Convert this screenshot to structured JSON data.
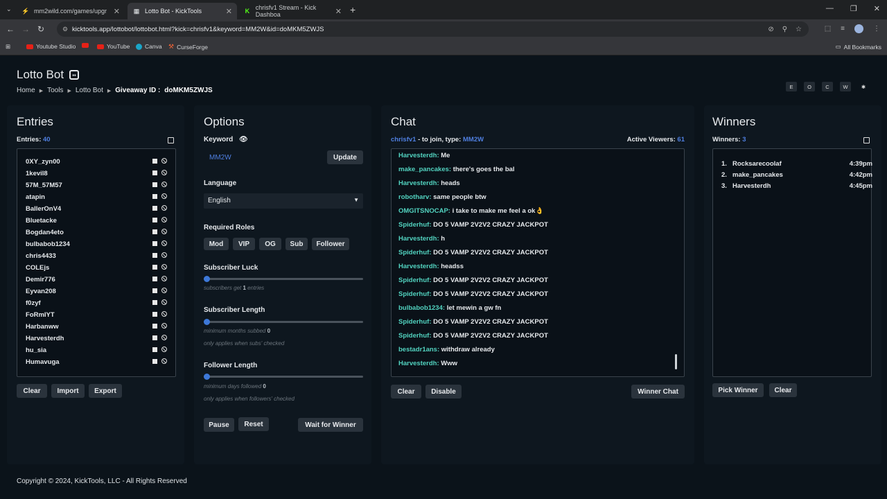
{
  "browser": {
    "tabs": [
      {
        "title": "mm2wild.com/games/upgr",
        "active": false
      },
      {
        "title": "Lotto Bot - KickTools",
        "active": true
      },
      {
        "title": "chrisfv1 Stream - Kick Dashboa",
        "active": false
      }
    ],
    "url": "kicktools.app/lottobot/lottobot.html?kick=chrisfv1&keyword=MM2W&id=doMKM5ZWJS",
    "bookmarks": [
      "Youtube Studio",
      "YouTube",
      "Canva",
      "CurseForge"
    ],
    "all_bookmarks": "All Bookmarks"
  },
  "header": {
    "title": "Lotto Bot",
    "breadcrumb": [
      "Home",
      "Tools",
      "Lotto Bot"
    ],
    "giveaway_label": "Giveaway ID :",
    "giveaway_id": "doMKM5ZWJS",
    "theme_buttons": [
      "E",
      "O",
      "C",
      "W",
      "✱"
    ]
  },
  "entries": {
    "title": "Entries",
    "count_label": "Entries:",
    "count": "40",
    "names": [
      "0XY_zyn00",
      "1kevil8",
      "57M_57M57",
      "atapin",
      "BallerOnV4",
      "Bluetacke",
      "Bogdan4eto",
      "bulbabob1234",
      "chris4433",
      "COLEjs",
      "Demir776",
      "Eyvan208",
      "f0zyf",
      "FoRmIYT",
      "Harbanww",
      "Harvesterdh",
      "hu_sia",
      "Humavuga"
    ],
    "buttons": [
      "Clear",
      "Import",
      "Export"
    ]
  },
  "options": {
    "title": "Options",
    "keyword_label": "Keyword",
    "keyword_value": "MM2W",
    "update_label": "Update",
    "language_label": "Language",
    "language_value": "English",
    "roles_label": "Required Roles",
    "roles": [
      "Mod",
      "VIP",
      "OG",
      "Sub",
      "Follower"
    ],
    "sub_luck_label": "Subscriber Luck",
    "sub_luck_hint_pre": "subscribers get",
    "sub_luck_value": "1",
    "sub_luck_hint_post": "entries",
    "sub_length_label": "Subscriber Length",
    "sub_length_hint": "minimum months subbed",
    "sub_length_value": "0",
    "sub_length_note": "only applies when subs' checked",
    "fol_length_label": "Follower Length",
    "fol_length_hint": "minimum days followed",
    "fol_length_value": "0",
    "fol_length_note": "only applies when followers' checked",
    "buttons": [
      "Pause",
      "Reset",
      "Wait for Winner"
    ]
  },
  "chat": {
    "title": "Chat",
    "channel": "chrisfv1",
    "join_text": "- to join, type:",
    "keyword": "MM2W",
    "viewers_label": "Active Viewers:",
    "viewers": "61",
    "messages": [
      {
        "user": "Harvesterdh:",
        "text": "Me"
      },
      {
        "user": "make_pancakes:",
        "text": "there's goes the bal"
      },
      {
        "user": "Harvesterdh:",
        "text": "heads"
      },
      {
        "user": "robotharv:",
        "text": "same people btw"
      },
      {
        "user": "OMGITSNOCAP:",
        "text": "i take to make me feel a ok👌"
      },
      {
        "user": "Spiderhuf:",
        "text": "DO 5 VAMP 2V2V2 CRAZY JACKPOT"
      },
      {
        "user": "Harvesterdh:",
        "text": "h"
      },
      {
        "user": "Spiderhuf:",
        "text": "DO 5 VAMP 2V2V2 CRAZY JACKPOT"
      },
      {
        "user": "Harvesterdh:",
        "text": "headss"
      },
      {
        "user": "Spiderhuf:",
        "text": "DO 5 VAMP 2V2V2 CRAZY JACKPOT"
      },
      {
        "user": "Spiderhuf:",
        "text": "DO 5 VAMP 2V2V2 CRAZY JACKPOT"
      },
      {
        "user": "bulbabob1234:",
        "text": "let mewin a gw fn"
      },
      {
        "user": "Spiderhuf:",
        "text": "DO 5 VAMP 2V2V2 CRAZY JACKPOT"
      },
      {
        "user": "Spiderhuf:",
        "text": "DO 5 VAMP 2V2V2 CRAZY JACKPOT"
      },
      {
        "user": "bestadr1ans:",
        "text": "withdraw already"
      },
      {
        "user": "Harvesterdh:",
        "text": "Www"
      }
    ],
    "buttons": [
      "Clear",
      "Disable",
      "Winner Chat"
    ]
  },
  "winners": {
    "title": "Winners",
    "count_label": "Winners:",
    "count": "3",
    "list": [
      {
        "num": "1.",
        "name": "Rocksarecoolaf",
        "time": "4:39pm"
      },
      {
        "num": "2.",
        "name": "make_pancakes",
        "time": "4:42pm"
      },
      {
        "num": "3.",
        "name": "Harvesterdh",
        "time": "4:45pm"
      }
    ],
    "buttons": [
      "Pick Winner",
      "Clear"
    ]
  },
  "footer": "Copyright © 2024, KickTools, LLC - All Rights Reserved"
}
